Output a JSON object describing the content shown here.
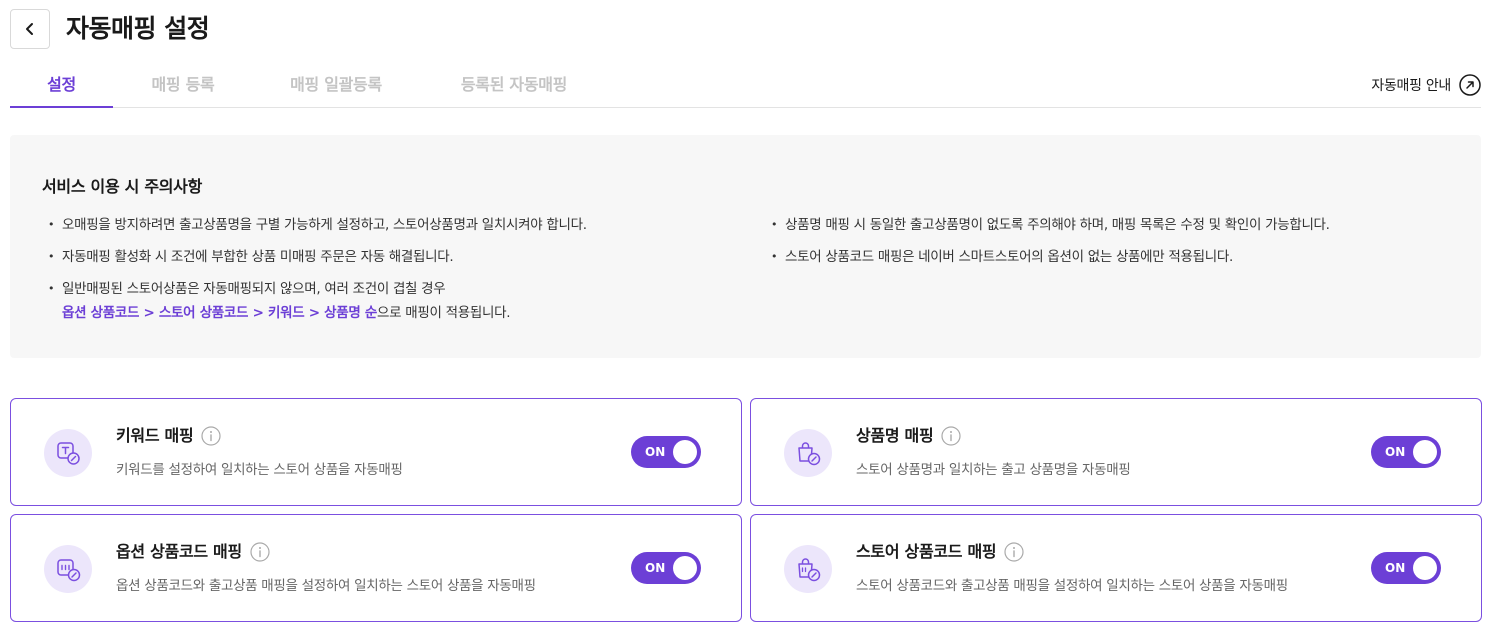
{
  "header": {
    "back_icon": "chevron-left-icon",
    "title": "자동매핑 설정"
  },
  "tabs": [
    {
      "label": "설정",
      "active": true
    },
    {
      "label": "매핑 등록",
      "active": false
    },
    {
      "label": "매핑 일괄등록",
      "active": false
    },
    {
      "label": "등록된 자동매핑",
      "active": false
    }
  ],
  "guide_link": {
    "label": "자동매핑 안내",
    "icon": "arrow-up-right-circle-icon"
  },
  "notice": {
    "title": "서비스 이용 시 주의사항",
    "left_items": [
      "오매핑을 방지하려면 출고상품명을 구별 가능하게 설정하고, 스토어상품명과 일치시켜야 합니다.",
      "자동매핑 활성화 시 조건에 부합한 상품 미매핑 주문은 자동 해결됩니다.",
      "일반매핑된 스토어상품은 자동매핑되지 않으며, 여러 조건이 겹칠 경우"
    ],
    "priority_text": "옵션 상품코드 > 스토어 상품코드 > 키워드 > 상품명 순",
    "priority_suffix": "으로 매핑이 적용됩니다.",
    "right_items": [
      "상품명 매핑 시 동일한 출고상품명이 없도록 주의해야 하며, 매핑 목록은 수정 및 확인이 가능합니다.",
      "스토어 상품코드 매핑은 네이버 스마트스토어의 옵션이 없는 상품에만 적용됩니다."
    ]
  },
  "cards": {
    "keyword": {
      "title": "키워드 매핑",
      "desc": "키워드를 설정하여 일치하는 스토어 상품을 자동매핑",
      "toggle": "ON"
    },
    "product_name": {
      "title": "상품명 매핑",
      "desc": "스토어 상품명과 일치하는 출고 상품명을 자동매핑",
      "toggle": "ON"
    },
    "option_code": {
      "title": "옵션 상품코드 매핑",
      "desc": "옵션 상품코드와 출고상품 매핑을 설정하여 일치하는 스토어 상품을 자동매핑",
      "toggle": "ON"
    },
    "store_code": {
      "title": "스토어 상품코드 매핑",
      "desc": "스토어 상품코드와 출고상품 매핑을 설정하여 일치하는 스토어 상품을 자동매핑",
      "toggle": "ON"
    }
  },
  "colors": {
    "accent": "#6c3fd6",
    "icon_bg": "#ece6fb",
    "notice_bg": "#f7f7f7"
  }
}
